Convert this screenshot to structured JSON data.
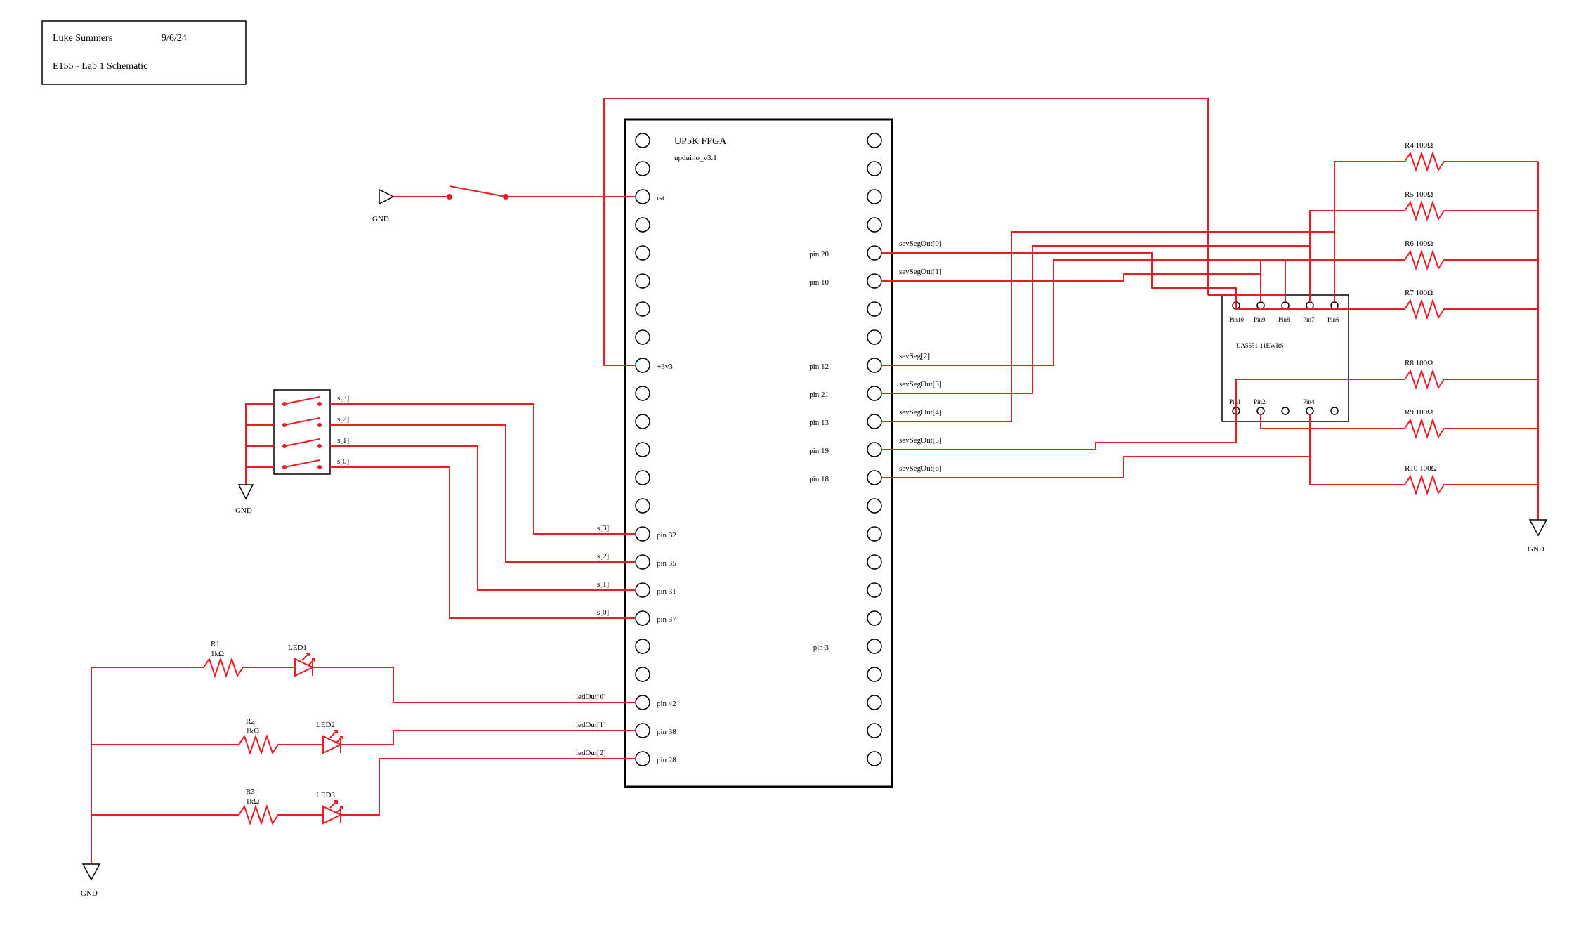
{
  "title_block": {
    "author": "Luke Summers",
    "date": "9/6/24",
    "course": "E155 - Lab 1  Schematic"
  },
  "fpga": {
    "name": "UP5K  FPGA",
    "board": "upduino_v3.1",
    "left_labels": {
      "rst": "rst",
      "v33": "+3v3",
      "s3": "s[3]",
      "s2": "s[2]",
      "s1": "s[1]",
      "s0": "s[0]",
      "led0": "ledOut[0]",
      "led1": "ledOut[1]",
      "led2": "ledOut[2]"
    },
    "left_pins": {
      "p32": "pin 32",
      "p35": "pin 35",
      "p31": "pin 31",
      "p37": "pin 37",
      "p42": "pin 42",
      "p38": "pin 38",
      "p28": "pin 28"
    },
    "right_labels": {
      "ss0": "sevSegOut[0]",
      "ss1": "sevSegOut[1]",
      "ss2": "sevSeg[2]",
      "ss3": "sevSegOut[3]",
      "ss4": "sevSegOut[4]",
      "ss5": "sevSegOut[5]",
      "ss6": "sevSegOut[6]"
    },
    "right_pins": {
      "p20": "pin 20",
      "p10": "pin 10",
      "p12": "pin 12",
      "p21": "pin 21",
      "p13": "pin 13",
      "p19": "pin 19",
      "p18": "pin 18",
      "p3": "pin 3"
    }
  },
  "gnd": "GND",
  "dip": {
    "s3": "s[3]",
    "s2": "s[2]",
    "s1": "s[1]",
    "s0": "s[0]"
  },
  "resistors_left": {
    "r1": "R1\n1kΩ",
    "r2": "R2\n1kΩ",
    "r3": "R3\n1kΩ"
  },
  "leds": {
    "l1": "LED1",
    "l2": "LED2",
    "l3": "LED3"
  },
  "resistors_right": {
    "r4": "R4 100Ω",
    "r5": "R5 100Ω",
    "r6": "R6 100Ω",
    "r7": "R7 100Ω",
    "r8": "R8 100Ω",
    "r9": "R9 100Ω",
    "r10": "R10 100Ω"
  },
  "display": {
    "part": "UA5651-11EWRS",
    "top_pins": [
      "Pin10",
      "Pin9",
      "Pin8",
      "Pin7",
      "Pin6"
    ],
    "bot_pins": [
      "Pin1",
      "Pin2",
      "",
      "Pin4",
      ""
    ]
  }
}
